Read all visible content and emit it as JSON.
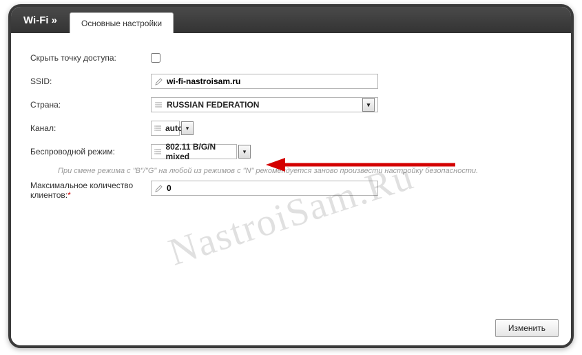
{
  "header": {
    "breadcrumb": "Wi-Fi »",
    "tab": "Основные настройки"
  },
  "form": {
    "hide_ap": {
      "label": "Скрыть точку доступа:",
      "checked": false
    },
    "ssid": {
      "label": "SSID:",
      "value": "wi-fi-nastroisam.ru"
    },
    "country": {
      "label": "Страна:",
      "value": "RUSSIAN FEDERATION"
    },
    "channel": {
      "label": "Канал:",
      "value": "auto"
    },
    "mode": {
      "label": "Беспроводной режим:",
      "value": "802.11 B/G/N mixed"
    },
    "note": "При смене режима с \"B\"/\"G\" на любой из режимов с \"N\" рекомендуется заново произвести настройку безопасности.",
    "clients": {
      "label": "Максимальное количество клиентов:",
      "value": "0",
      "required": true
    }
  },
  "footer": {
    "apply": "Изменить"
  },
  "watermark": "NastroiSam.Ru",
  "icons": {
    "pencil": "pencil-icon",
    "list": "list-icon",
    "chevron": "▾",
    "side": "◀"
  }
}
